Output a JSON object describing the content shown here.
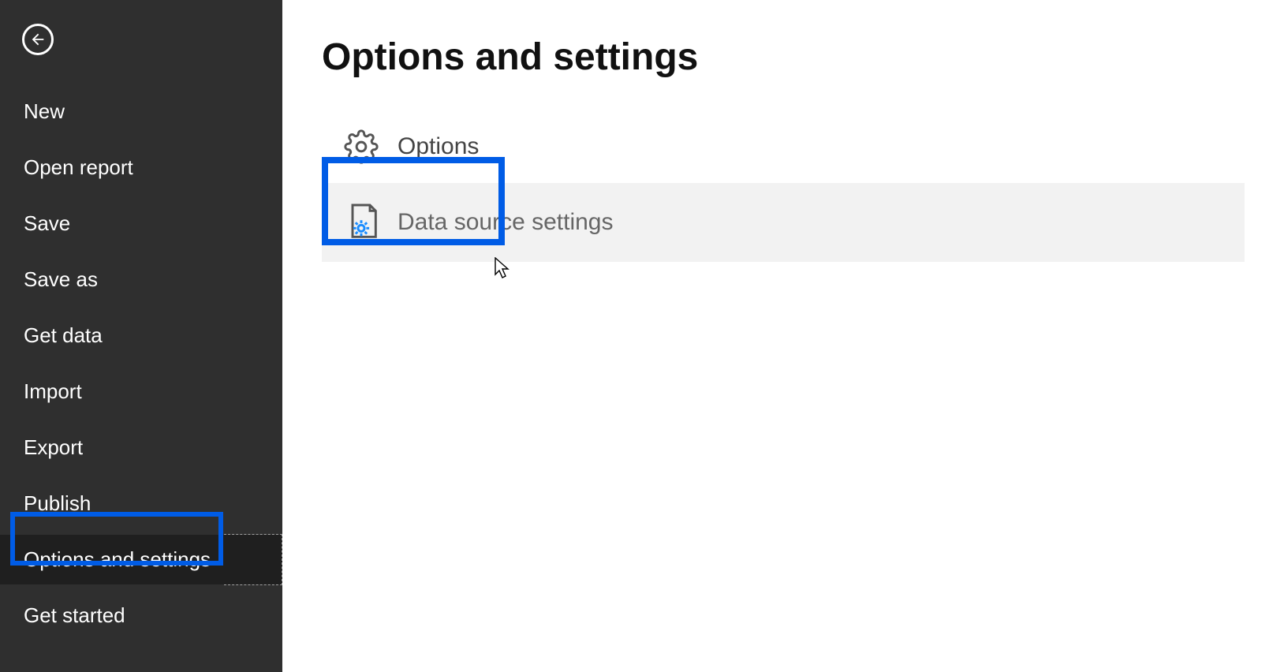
{
  "sidebar": {
    "items": [
      {
        "label": "New"
      },
      {
        "label": "Open report"
      },
      {
        "label": "Save"
      },
      {
        "label": "Save as"
      },
      {
        "label": "Get data"
      },
      {
        "label": "Import"
      },
      {
        "label": "Export"
      },
      {
        "label": "Publish"
      },
      {
        "label": "Options and settings"
      },
      {
        "label": "Get started"
      }
    ],
    "selected_index": 8
  },
  "content": {
    "title": "Options and settings",
    "items": [
      {
        "label": "Options"
      },
      {
        "label": "Data source settings"
      }
    ]
  }
}
